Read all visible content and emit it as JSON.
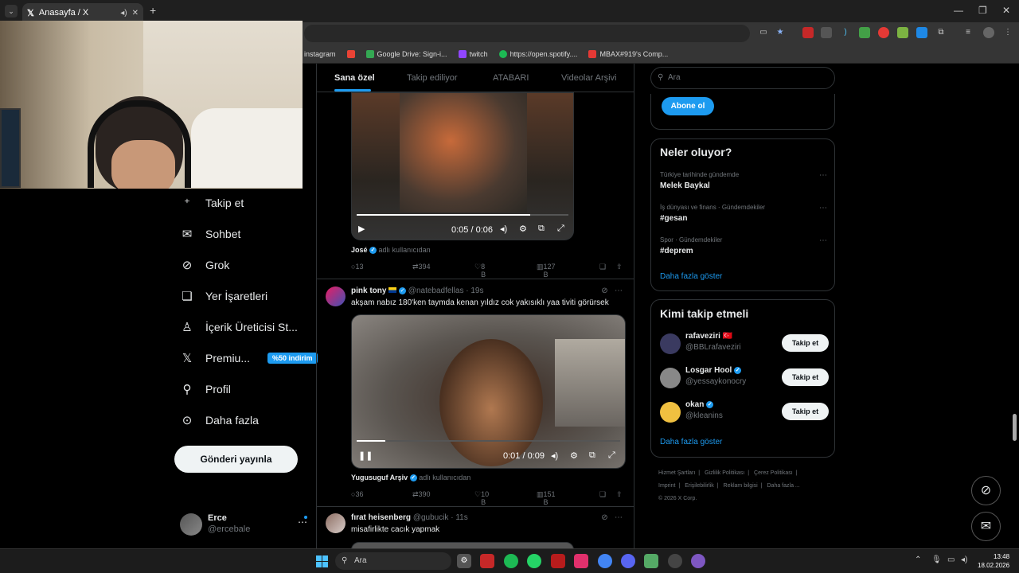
{
  "browser": {
    "tab_title": "Anasayfa / X",
    "new_tab_symbol": "+",
    "bookmarks": [
      {
        "label": "instagram",
        "color": "#c13584"
      },
      {
        "label": "",
        "color": "#ea4335"
      },
      {
        "label": "Google Drive: Sign-i...",
        "color": "#34a853"
      },
      {
        "label": "twitch",
        "color": "#9146ff"
      },
      {
        "label": "https://open.spotify....",
        "color": "#1db954"
      },
      {
        "label": "MBAX#919's Comp...",
        "color": "#e53935"
      }
    ]
  },
  "nav": {
    "items": [
      {
        "label": "Takip et",
        "icon": "person-add-icon",
        "glyph": "⁺"
      },
      {
        "label": "Sohbet",
        "icon": "mail-icon",
        "glyph": "✉"
      },
      {
        "label": "Grok",
        "icon": "grok-icon",
        "glyph": "⊘"
      },
      {
        "label": "Yer İşaretleri",
        "icon": "bookmark-icon",
        "glyph": "⌂"
      },
      {
        "label": "İçerik Üreticisi St...",
        "icon": "creator-studio-icon",
        "glyph": "♙"
      },
      {
        "label": "Premiu...",
        "icon": "x-logo-icon",
        "glyph": "𝕏"
      },
      {
        "label": "Profil",
        "icon": "profile-icon",
        "glyph": "⚲"
      },
      {
        "label": "Daha fazla",
        "icon": "more-circle-icon",
        "glyph": "⋯"
      }
    ],
    "premium_badge": "%50 indirim",
    "post_button": "Gönderi yayınla",
    "account": {
      "name": "Erce",
      "handle": "@ercebale",
      "more": "⋯"
    }
  },
  "feed": {
    "tabs": [
      "Sana özel",
      "Takip ediliyor",
      "ATABARI",
      "Videolar Arşivi"
    ],
    "post1": {
      "video_time": "0:05 / 0:06",
      "progress": 0.82,
      "author": "José",
      "author_suffix": "adlı kullanıcıdan",
      "replies": "13",
      "reposts": "394",
      "likes": "8 B",
      "views": "127 B"
    },
    "post2": {
      "name": "pink tony",
      "handle": "@natebadfellas",
      "time": "· 19s",
      "text": "akşam nabız 180'ken taymda kenan yıldız cok yakısıklı yaa tiviti görürsek",
      "video_time": "0:01 / 0:09",
      "progress": 0.11,
      "author": "Yugusuguf Arşiv",
      "author_suffix": "adlı kullanıcıdan",
      "replies": "36",
      "reposts": "390",
      "likes": "10 B",
      "views": "151 B"
    },
    "post3": {
      "name": "fırat heisenberg",
      "handle": "@gubucik",
      "time": "· 11s",
      "text": "misafirlikte cacık yapmak"
    }
  },
  "right": {
    "search_placeholder": "Ara",
    "subscribe_button": "Abone ol",
    "trends_title": "Neler oluyor?",
    "trends": [
      {
        "context": "Türkiye tarihinde gündemde",
        "topic": "Melek Baykal"
      },
      {
        "context": "İş dünyası ve finans · Gündemdekiler",
        "topic": "#gesan"
      },
      {
        "context": "Spor · Gündemdekiler",
        "topic": "#deprem"
      }
    ],
    "show_more": "Daha fazla göster",
    "who_title": "Kimi takip etmeli",
    "who": [
      {
        "name": "rafaveziri 🇹🇷",
        "handle": "@BBLrafaveziri",
        "button": "Takip et",
        "color": "#3a3a60"
      },
      {
        "name": "Losgar Hool",
        "handle": "@yessaykonocry",
        "button": "Takip et",
        "color": "#888"
      },
      {
        "name": "okan",
        "handle": "@kleanins",
        "button": "Takip et",
        "color": "#f0c040"
      }
    ],
    "footer": [
      "Hizmet Şartları",
      "|",
      "Gizlilik Politikası",
      "|",
      "Çerez Politikası",
      "|",
      "Imprint",
      "|",
      "Erişilebilirlik",
      "|",
      "Reklam bilgisi",
      "|",
      "Daha fazla ...",
      "© 2026 X Corp."
    ]
  },
  "taskbar": {
    "search": "Ara",
    "time": "13:48",
    "date": "18.02.2026"
  }
}
